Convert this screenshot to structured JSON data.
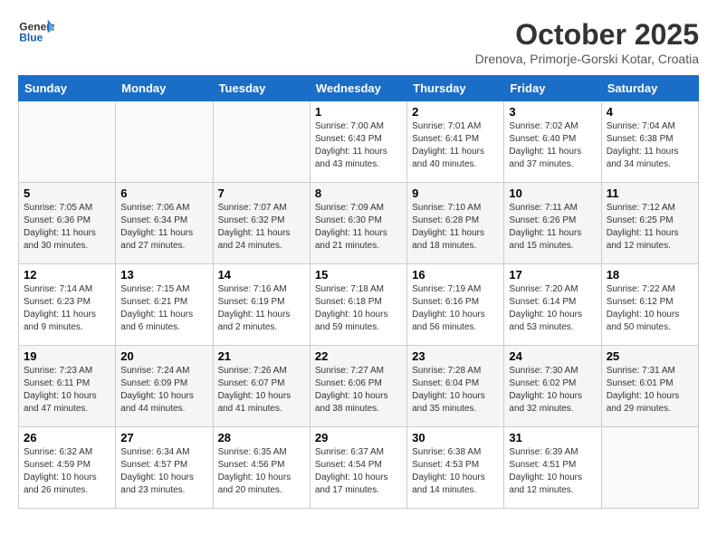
{
  "header": {
    "logo_general": "General",
    "logo_blue": "Blue",
    "title": "October 2025",
    "subtitle": "Drenova, Primorje-Gorski Kotar, Croatia"
  },
  "weekdays": [
    "Sunday",
    "Monday",
    "Tuesday",
    "Wednesday",
    "Thursday",
    "Friday",
    "Saturday"
  ],
  "weeks": [
    [
      {
        "day": "",
        "info": ""
      },
      {
        "day": "",
        "info": ""
      },
      {
        "day": "",
        "info": ""
      },
      {
        "day": "1",
        "info": "Sunrise: 7:00 AM\nSunset: 6:43 PM\nDaylight: 11 hours\nand 43 minutes."
      },
      {
        "day": "2",
        "info": "Sunrise: 7:01 AM\nSunset: 6:41 PM\nDaylight: 11 hours\nand 40 minutes."
      },
      {
        "day": "3",
        "info": "Sunrise: 7:02 AM\nSunset: 6:40 PM\nDaylight: 11 hours\nand 37 minutes."
      },
      {
        "day": "4",
        "info": "Sunrise: 7:04 AM\nSunset: 6:38 PM\nDaylight: 11 hours\nand 34 minutes."
      }
    ],
    [
      {
        "day": "5",
        "info": "Sunrise: 7:05 AM\nSunset: 6:36 PM\nDaylight: 11 hours\nand 30 minutes."
      },
      {
        "day": "6",
        "info": "Sunrise: 7:06 AM\nSunset: 6:34 PM\nDaylight: 11 hours\nand 27 minutes."
      },
      {
        "day": "7",
        "info": "Sunrise: 7:07 AM\nSunset: 6:32 PM\nDaylight: 11 hours\nand 24 minutes."
      },
      {
        "day": "8",
        "info": "Sunrise: 7:09 AM\nSunset: 6:30 PM\nDaylight: 11 hours\nand 21 minutes."
      },
      {
        "day": "9",
        "info": "Sunrise: 7:10 AM\nSunset: 6:28 PM\nDaylight: 11 hours\nand 18 minutes."
      },
      {
        "day": "10",
        "info": "Sunrise: 7:11 AM\nSunset: 6:26 PM\nDaylight: 11 hours\nand 15 minutes."
      },
      {
        "day": "11",
        "info": "Sunrise: 7:12 AM\nSunset: 6:25 PM\nDaylight: 11 hours\nand 12 minutes."
      }
    ],
    [
      {
        "day": "12",
        "info": "Sunrise: 7:14 AM\nSunset: 6:23 PM\nDaylight: 11 hours\nand 9 minutes."
      },
      {
        "day": "13",
        "info": "Sunrise: 7:15 AM\nSunset: 6:21 PM\nDaylight: 11 hours\nand 6 minutes."
      },
      {
        "day": "14",
        "info": "Sunrise: 7:16 AM\nSunset: 6:19 PM\nDaylight: 11 hours\nand 2 minutes."
      },
      {
        "day": "15",
        "info": "Sunrise: 7:18 AM\nSunset: 6:18 PM\nDaylight: 10 hours\nand 59 minutes."
      },
      {
        "day": "16",
        "info": "Sunrise: 7:19 AM\nSunset: 6:16 PM\nDaylight: 10 hours\nand 56 minutes."
      },
      {
        "day": "17",
        "info": "Sunrise: 7:20 AM\nSunset: 6:14 PM\nDaylight: 10 hours\nand 53 minutes."
      },
      {
        "day": "18",
        "info": "Sunrise: 7:22 AM\nSunset: 6:12 PM\nDaylight: 10 hours\nand 50 minutes."
      }
    ],
    [
      {
        "day": "19",
        "info": "Sunrise: 7:23 AM\nSunset: 6:11 PM\nDaylight: 10 hours\nand 47 minutes."
      },
      {
        "day": "20",
        "info": "Sunrise: 7:24 AM\nSunset: 6:09 PM\nDaylight: 10 hours\nand 44 minutes."
      },
      {
        "day": "21",
        "info": "Sunrise: 7:26 AM\nSunset: 6:07 PM\nDaylight: 10 hours\nand 41 minutes."
      },
      {
        "day": "22",
        "info": "Sunrise: 7:27 AM\nSunset: 6:06 PM\nDaylight: 10 hours\nand 38 minutes."
      },
      {
        "day": "23",
        "info": "Sunrise: 7:28 AM\nSunset: 6:04 PM\nDaylight: 10 hours\nand 35 minutes."
      },
      {
        "day": "24",
        "info": "Sunrise: 7:30 AM\nSunset: 6:02 PM\nDaylight: 10 hours\nand 32 minutes."
      },
      {
        "day": "25",
        "info": "Sunrise: 7:31 AM\nSunset: 6:01 PM\nDaylight: 10 hours\nand 29 minutes."
      }
    ],
    [
      {
        "day": "26",
        "info": "Sunrise: 6:32 AM\nSunset: 4:59 PM\nDaylight: 10 hours\nand 26 minutes."
      },
      {
        "day": "27",
        "info": "Sunrise: 6:34 AM\nSunset: 4:57 PM\nDaylight: 10 hours\nand 23 minutes."
      },
      {
        "day": "28",
        "info": "Sunrise: 6:35 AM\nSunset: 4:56 PM\nDaylight: 10 hours\nand 20 minutes."
      },
      {
        "day": "29",
        "info": "Sunrise: 6:37 AM\nSunset: 4:54 PM\nDaylight: 10 hours\nand 17 minutes."
      },
      {
        "day": "30",
        "info": "Sunrise: 6:38 AM\nSunset: 4:53 PM\nDaylight: 10 hours\nand 14 minutes."
      },
      {
        "day": "31",
        "info": "Sunrise: 6:39 AM\nSunset: 4:51 PM\nDaylight: 10 hours\nand 12 minutes."
      },
      {
        "day": "",
        "info": ""
      }
    ]
  ]
}
